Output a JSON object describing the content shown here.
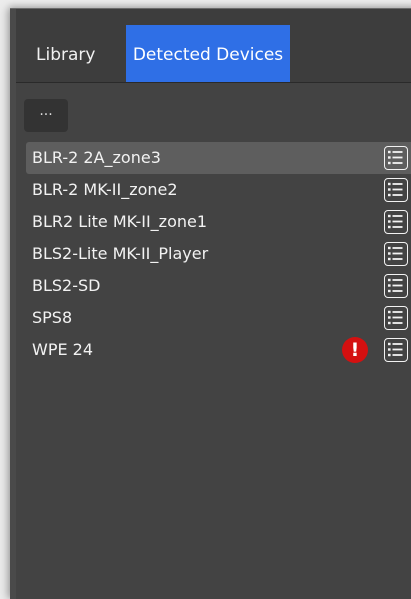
{
  "tabs": {
    "library": "Library",
    "detected": "Detected Devices"
  },
  "toolbar": {
    "more_label": "..."
  },
  "devices": [
    {
      "name": "BLR-2 2A_zone3",
      "selected": true,
      "alert": false
    },
    {
      "name": "BLR-2 MK-II_zone2",
      "selected": false,
      "alert": false
    },
    {
      "name": "BLR2 Lite MK-II_zone1",
      "selected": false,
      "alert": false
    },
    {
      "name": "BLS2-Lite MK-II_Player",
      "selected": false,
      "alert": false
    },
    {
      "name": "BLS2-SD",
      "selected": false,
      "alert": false
    },
    {
      "name": "SPS8",
      "selected": false,
      "alert": false
    },
    {
      "name": "WPE 24",
      "selected": false,
      "alert": true
    }
  ],
  "icons": {
    "row_menu": "list-menu-icon",
    "alert": "exclamation-icon",
    "alert_glyph": "!"
  },
  "colors": {
    "active_tab": "#2f6fe6",
    "alert": "#d41010",
    "selected_row": "#5e5e5e"
  }
}
